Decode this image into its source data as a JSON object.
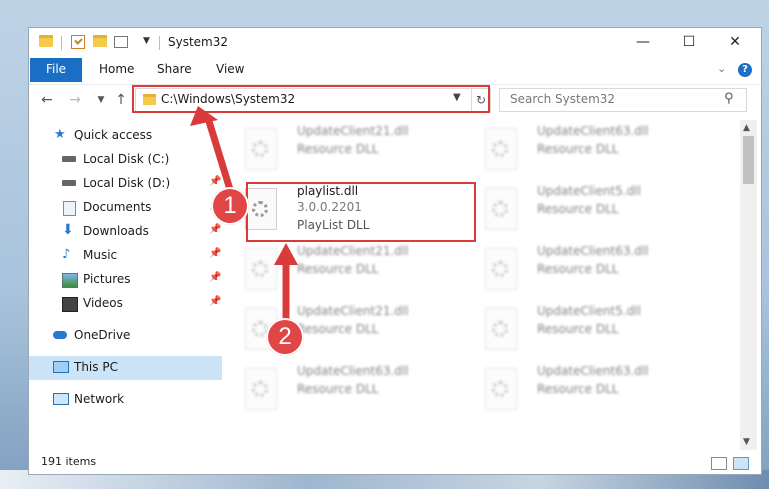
{
  "window": {
    "title": "System32",
    "controls": {
      "minimize": "—",
      "maximize": "☐",
      "close": "✕"
    }
  },
  "ribbon": {
    "tabs": [
      {
        "label": "File",
        "active": true
      },
      {
        "label": "Home"
      },
      {
        "label": "Share"
      },
      {
        "label": "View"
      }
    ]
  },
  "navigation": {
    "address": "C:\\Windows\\System32",
    "search_placeholder": "Search System32"
  },
  "sidebar": {
    "items": [
      {
        "label": "Quick access",
        "icon": "star-icon"
      },
      {
        "label": "Local Disk (C:)",
        "icon": "drive-icon"
      },
      {
        "label": "Local Disk (D:)",
        "icon": "drive-icon"
      },
      {
        "label": "Documents",
        "icon": "document-icon"
      },
      {
        "label": "Downloads",
        "icon": "download-icon"
      },
      {
        "label": "Music",
        "icon": "music-icon"
      },
      {
        "label": "Pictures",
        "icon": "picture-icon"
      },
      {
        "label": "Videos",
        "icon": "video-icon"
      },
      {
        "label": "OneDrive",
        "icon": "cloud-icon"
      },
      {
        "label": "This PC",
        "icon": "computer-icon",
        "selected": true
      },
      {
        "label": "Network",
        "icon": "network-icon"
      }
    ]
  },
  "files": {
    "highlighted": {
      "name": "playlist.dll",
      "version": "3.0.0.2201",
      "description": "PlayList DLL"
    },
    "blurred": [
      {
        "name": "UpdateClient21.dll",
        "description": "Resource DLL"
      },
      {
        "name": "UpdateClient63.dll",
        "description": "Resource DLL"
      },
      {
        "name": "UpdateClient5.dll",
        "description": "Resource DLL"
      },
      {
        "name": "UpdateClient21.dll",
        "description": "Resource DLL"
      },
      {
        "name": "UpdateClient63.dll",
        "description": "Resource DLL"
      },
      {
        "name": "UpdateClient21.dll",
        "description": "Resource DLL"
      },
      {
        "name": "UpdateClient5.dll",
        "description": "Resource DLL"
      },
      {
        "name": "UpdateClient63.dll",
        "description": "Resource DLL"
      },
      {
        "name": "UpdateClient63.dll",
        "description": "Resource DLL"
      }
    ]
  },
  "status": {
    "item_count": "191 items"
  },
  "annotations": {
    "step1": "1",
    "step2": "2",
    "color": "#d93b3b"
  }
}
